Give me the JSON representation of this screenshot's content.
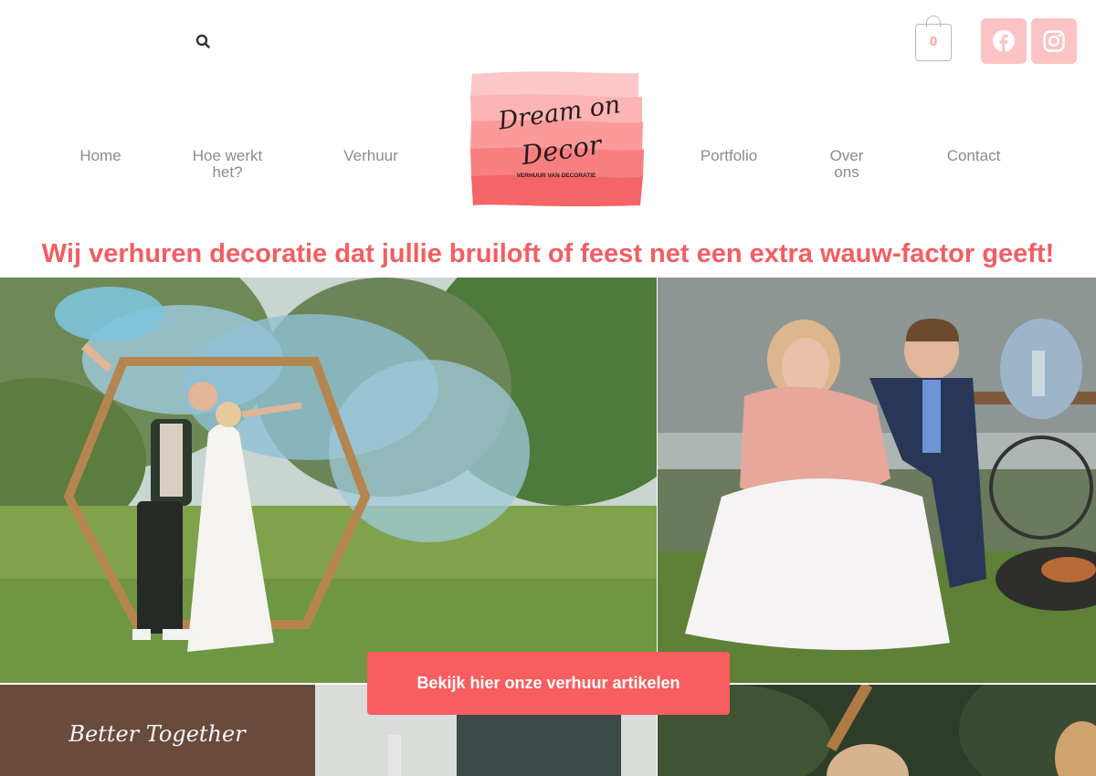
{
  "header": {
    "search_icon": "search-icon",
    "cart": {
      "icon": "shopping-bag-icon",
      "count": "0"
    },
    "social": [
      {
        "name": "facebook",
        "icon": "facebook-icon"
      },
      {
        "name": "instagram",
        "icon": "instagram-icon"
      }
    ]
  },
  "nav": {
    "left": [
      {
        "label": "Home"
      },
      {
        "label": "Hoe werkt het?"
      },
      {
        "label": "Verhuur"
      }
    ],
    "right": [
      {
        "label": "Portfolio"
      },
      {
        "label": "Over ons"
      },
      {
        "label": "Contact"
      }
    ]
  },
  "logo": {
    "line1": "Dream on",
    "line2": "Decor",
    "subtitle": "VERHUUR VAN DECORATIE"
  },
  "hero": {
    "tagline": "Wij verhuren decoratie dat jullie bruiloft of feest net een extra wauw-factor geeft!",
    "cta_label": "Bekijk hier onze verhuur artikelen",
    "sign_text": "Better Together"
  },
  "colors": {
    "accent": "#f25e62",
    "button": "#f85d5f",
    "social_bg": "#fcc3c5",
    "nav_text": "#8b8b8b"
  }
}
